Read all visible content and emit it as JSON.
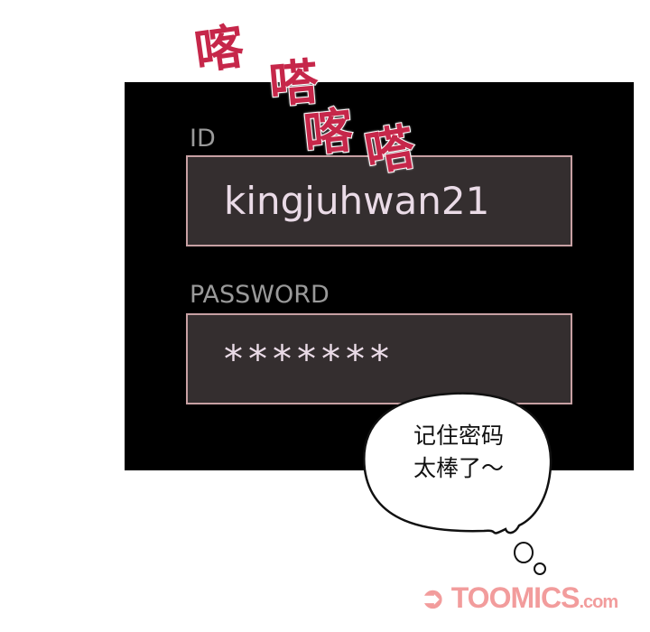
{
  "login": {
    "id_label": "ID",
    "id_value": "kingjuhwan21",
    "password_label": "PASSWORD",
    "password_value": "*******"
  },
  "sound_effects": [
    "喀",
    "嗒",
    "喀",
    "嗒"
  ],
  "thought_bubble": {
    "line1": "记住密码",
    "line2": "太棒了～"
  },
  "watermark": {
    "text": "TOOMICS",
    "suffix": ".com"
  },
  "colors": {
    "sfx": "#c6274a",
    "field_border": "#c7a0a3",
    "field_fill": "#342e2f",
    "watermark": "#f29c9c"
  }
}
